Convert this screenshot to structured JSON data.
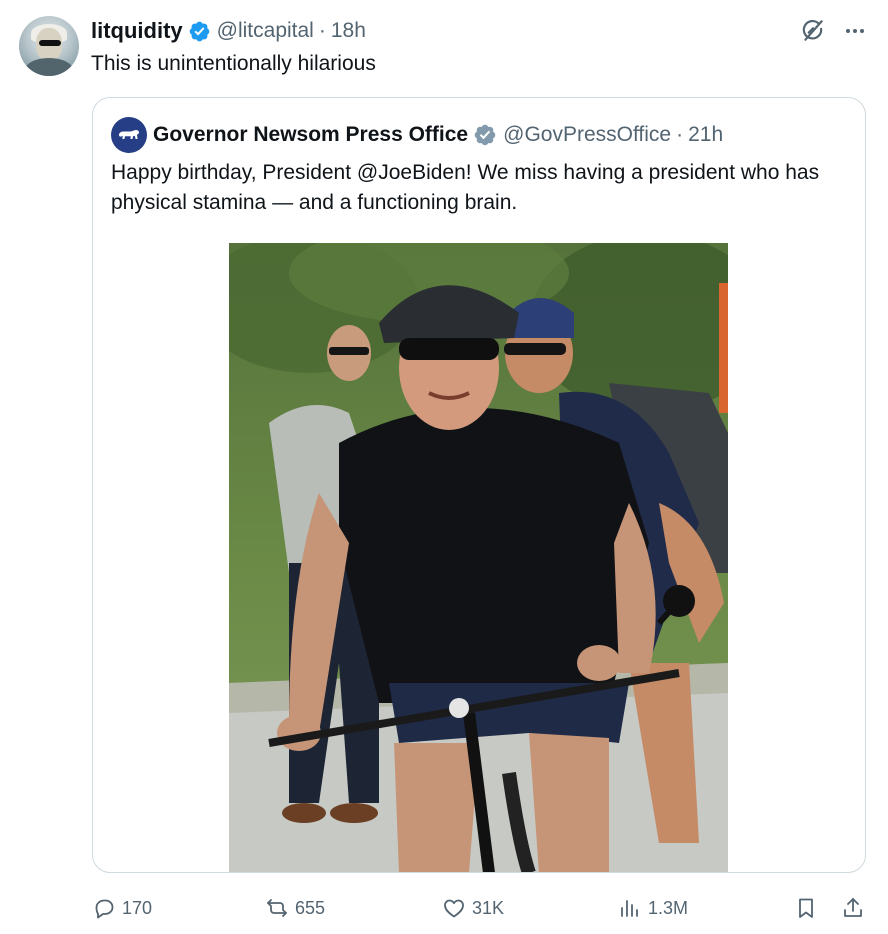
{
  "tweet": {
    "display_name": "litquidity",
    "handle": "@litcapital",
    "separator": "·",
    "time": "18h",
    "text": "This is unintentionally hilarious",
    "avatar_icon": "user-avatar-icon"
  },
  "quoted": {
    "display_name": "Governor Newsom Press Office",
    "handle": "@GovPressOffice",
    "separator": "·",
    "time": "21h",
    "text": "Happy birthday, President @JoeBiden! We miss having a president who has physical stamina — and a functioning brain.",
    "avatar_icon": "california-bear-icon",
    "verified_badge": "gray",
    "image_icon": "bike-photo"
  },
  "metrics": {
    "replies": "170",
    "reposts": "655",
    "likes": "31K",
    "views": "1.3M"
  },
  "colors": {
    "verified_blue": "#1d9bf0",
    "verified_gray": "#829aab",
    "secondary_text": "#536471",
    "border": "#cfd9de",
    "quote_avatar": "#253e86"
  }
}
